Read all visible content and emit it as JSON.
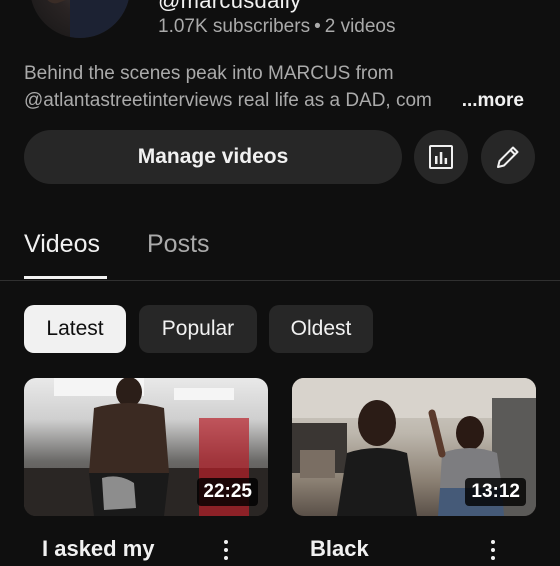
{
  "channel": {
    "handle": "@marcusdaily",
    "subscribers": "1.07K subscribers",
    "separator": "•",
    "videos_count": "2 videos",
    "description_line1": "Behind the scenes peak into MARCUS from",
    "description_line2": "@atlantastreetinterviews real life as a DAD, com",
    "more_label": "...more"
  },
  "actions": {
    "manage_label": "Manage videos",
    "analytics_icon": "analytics-icon",
    "edit_icon": "pencil-icon"
  },
  "tabs": [
    {
      "label": "Videos",
      "active": true
    },
    {
      "label": "Posts",
      "active": false
    }
  ],
  "chips": [
    {
      "label": "Latest",
      "active": true
    },
    {
      "label": "Popular",
      "active": false
    },
    {
      "label": "Oldest",
      "active": false
    }
  ],
  "videos": [
    {
      "duration": "22:25",
      "title": "I asked my"
    },
    {
      "duration": "13:12",
      "title": "Black"
    }
  ],
  "colors": {
    "background": "#0f0f0f",
    "surface": "#272727",
    "text_primary": "#f1f1f1",
    "text_secondary": "#aaaaaa"
  }
}
